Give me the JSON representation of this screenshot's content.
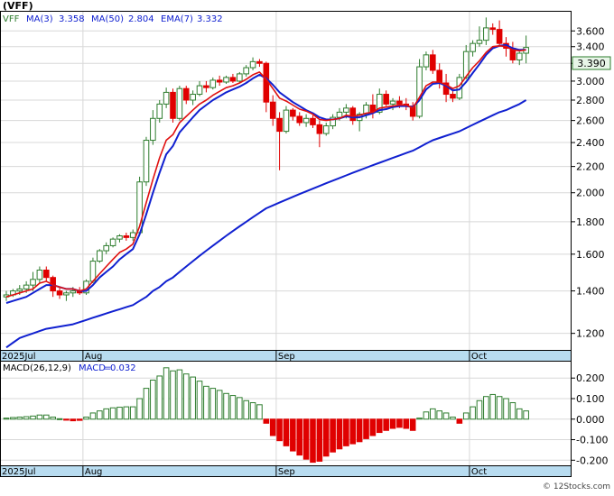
{
  "header": {
    "symbol": "(VFF)",
    "ticker": "VFF",
    "ma3_label": "MA(3)",
    "ma3_value": "3.358",
    "ma50_label": "MA(50)",
    "ma50_value": "2.804",
    "ema7_label": "EMA(7)",
    "ema7_value": "3.332",
    "last_price": "3.390"
  },
  "macd_header": {
    "params": "MACD(26,12,9)",
    "label": "MACD",
    "value": "0.032"
  },
  "x_labels": [
    "2025Jul",
    "Aug",
    "Sep",
    "Oct"
  ],
  "footer": "© 12Stocks.com",
  "colors": {
    "up": "#2e7d2e",
    "down": "#e00000",
    "ma_fast": "#1020d0",
    "ema": "#e01010",
    "ma_slow": "#1020d0",
    "axis_band": "#b8dcf0",
    "grid": "#d8d8d8",
    "price_box": "#e8f5e8"
  },
  "chart_data": [
    {
      "type": "candlestick",
      "title": "VFF",
      "scale": "log",
      "ylim": [
        1.13,
        3.86
      ],
      "yticks": [
        1.2,
        1.4,
        1.6,
        1.8,
        2.0,
        2.2,
        2.4,
        2.6,
        2.8,
        3.0,
        3.2,
        3.4,
        3.6
      ],
      "ytick_labels": [
        "1.200",
        "1.400",
        "1.600",
        "1.800",
        "2.000",
        "2.200",
        "2.400",
        "2.600",
        "2.800",
        "3.000",
        "3.200",
        "3.400",
        "3.600"
      ],
      "x_label_index": {
        "2025Jul": 0,
        "Aug": 12,
        "Sep": 41,
        "Oct": 70
      },
      "ohlc": [
        [
          1.37,
          1.4,
          1.35,
          1.38
        ],
        [
          1.38,
          1.41,
          1.37,
          1.4
        ],
        [
          1.4,
          1.43,
          1.38,
          1.41
        ],
        [
          1.41,
          1.45,
          1.39,
          1.43
        ],
        [
          1.43,
          1.5,
          1.4,
          1.46
        ],
        [
          1.46,
          1.53,
          1.44,
          1.51
        ],
        [
          1.51,
          1.53,
          1.45,
          1.47
        ],
        [
          1.47,
          1.48,
          1.37,
          1.4
        ],
        [
          1.4,
          1.42,
          1.36,
          1.38
        ],
        [
          1.38,
          1.4,
          1.35,
          1.39
        ],
        [
          1.39,
          1.42,
          1.37,
          1.4
        ],
        [
          1.4,
          1.42,
          1.38,
          1.39
        ],
        [
          1.39,
          1.46,
          1.38,
          1.45
        ],
        [
          1.45,
          1.58,
          1.44,
          1.56
        ],
        [
          1.56,
          1.63,
          1.55,
          1.62
        ],
        [
          1.62,
          1.67,
          1.6,
          1.65
        ],
        [
          1.65,
          1.7,
          1.64,
          1.69
        ],
        [
          1.69,
          1.72,
          1.67,
          1.71
        ],
        [
          1.71,
          1.73,
          1.68,
          1.7
        ],
        [
          1.7,
          1.75,
          1.68,
          1.73
        ],
        [
          1.73,
          2.12,
          1.72,
          2.08
        ],
        [
          2.08,
          2.45,
          2.05,
          2.42
        ],
        [
          2.42,
          2.7,
          2.38,
          2.62
        ],
        [
          2.62,
          2.8,
          2.58,
          2.76
        ],
        [
          2.76,
          2.93,
          2.72,
          2.88
        ],
        [
          2.88,
          2.92,
          2.58,
          2.62
        ],
        [
          2.62,
          2.95,
          2.6,
          2.92
        ],
        [
          2.92,
          2.95,
          2.76,
          2.8
        ],
        [
          2.8,
          2.9,
          2.75,
          2.86
        ],
        [
          2.86,
          3.0,
          2.84,
          2.95
        ],
        [
          2.95,
          3.0,
          2.88,
          2.93
        ],
        [
          2.93,
          3.04,
          2.91,
          3.01
        ],
        [
          3.01,
          3.06,
          2.95,
          2.99
        ],
        [
          2.99,
          3.06,
          2.97,
          3.04
        ],
        [
          3.04,
          3.08,
          2.98,
          3.0
        ],
        [
          3.0,
          3.1,
          2.98,
          3.08
        ],
        [
          3.08,
          3.18,
          3.05,
          3.15
        ],
        [
          3.15,
          3.27,
          3.12,
          3.22
        ],
        [
          3.22,
          3.25,
          3.16,
          3.2
        ],
        [
          3.2,
          3.22,
          2.68,
          2.78
        ],
        [
          2.78,
          2.85,
          2.55,
          2.62
        ],
        [
          2.62,
          2.68,
          2.17,
          2.5
        ],
        [
          2.5,
          2.74,
          2.48,
          2.7
        ],
        [
          2.7,
          2.72,
          2.6,
          2.64
        ],
        [
          2.64,
          2.68,
          2.55,
          2.58
        ],
        [
          2.58,
          2.66,
          2.54,
          2.62
        ],
        [
          2.62,
          2.65,
          2.53,
          2.56
        ],
        [
          2.56,
          2.6,
          2.36,
          2.48
        ],
        [
          2.48,
          2.58,
          2.46,
          2.55
        ],
        [
          2.55,
          2.66,
          2.52,
          2.63
        ],
        [
          2.63,
          2.72,
          2.6,
          2.68
        ],
        [
          2.68,
          2.76,
          2.62,
          2.72
        ],
        [
          2.72,
          2.74,
          2.56,
          2.6
        ],
        [
          2.6,
          2.68,
          2.5,
          2.66
        ],
        [
          2.66,
          2.78,
          2.62,
          2.75
        ],
        [
          2.75,
          2.86,
          2.62,
          2.68
        ],
        [
          2.68,
          2.92,
          2.66,
          2.86
        ],
        [
          2.86,
          2.9,
          2.74,
          2.76
        ],
        [
          2.76,
          2.82,
          2.7,
          2.79
        ],
        [
          2.79,
          2.84,
          2.72,
          2.76
        ],
        [
          2.76,
          2.82,
          2.7,
          2.74
        ],
        [
          2.74,
          2.78,
          2.6,
          2.64
        ],
        [
          2.64,
          3.25,
          2.62,
          3.16
        ],
        [
          3.16,
          3.34,
          3.12,
          3.3
        ],
        [
          3.3,
          3.36,
          3.08,
          3.12
        ],
        [
          3.12,
          3.2,
          2.92,
          2.98
        ],
        [
          2.98,
          3.08,
          2.78,
          2.86
        ],
        [
          2.86,
          2.9,
          2.78,
          2.82
        ],
        [
          2.82,
          3.08,
          2.8,
          3.04
        ],
        [
          3.04,
          3.42,
          3.02,
          3.34
        ],
        [
          3.34,
          3.48,
          3.28,
          3.44
        ],
        [
          3.44,
          3.66,
          3.4,
          3.48
        ],
        [
          3.48,
          3.78,
          3.42,
          3.64
        ],
        [
          3.64,
          3.7,
          3.55,
          3.62
        ],
        [
          3.62,
          3.74,
          3.4,
          3.44
        ],
        [
          3.44,
          3.52,
          3.28,
          3.38
        ],
        [
          3.38,
          3.46,
          3.2,
          3.24
        ],
        [
          3.24,
          3.34,
          3.18,
          3.32
        ],
        [
          3.32,
          3.54,
          3.2,
          3.39
        ]
      ],
      "ma3": [
        1.37,
        1.39,
        1.4,
        1.41,
        1.43,
        1.47,
        1.48,
        1.46,
        1.42,
        1.39,
        1.39,
        1.39,
        1.41,
        1.47,
        1.54,
        1.61,
        1.65,
        1.68,
        1.7,
        1.71,
        1.84,
        2.08,
        2.37,
        2.6,
        2.75,
        2.75,
        2.81,
        2.85,
        2.86,
        2.87,
        2.91,
        2.96,
        2.98,
        3.01,
        3.01,
        3.04,
        3.08,
        3.15,
        3.19,
        3.07,
        2.87,
        2.63,
        2.61,
        2.61,
        2.64,
        2.61,
        2.59,
        2.55,
        2.53,
        2.55,
        2.62,
        2.68,
        2.67,
        2.66,
        2.7,
        2.7,
        2.76,
        2.77,
        2.8,
        2.77,
        2.76,
        2.71,
        2.85,
        3.03,
        3.19,
        3.13,
        2.99,
        2.89,
        2.91,
        3.07,
        3.27,
        3.42,
        3.52,
        3.58,
        3.57,
        3.48,
        3.35,
        3.31,
        3.36
      ],
      "ema7": [
        1.37,
        1.38,
        1.39,
        1.4,
        1.41,
        1.44,
        1.45,
        1.43,
        1.42,
        1.41,
        1.41,
        1.4,
        1.41,
        1.45,
        1.49,
        1.53,
        1.57,
        1.61,
        1.63,
        1.66,
        1.77,
        1.93,
        2.1,
        2.27,
        2.42,
        2.47,
        2.58,
        2.64,
        2.7,
        2.76,
        2.8,
        2.85,
        2.89,
        2.93,
        2.95,
        2.98,
        3.02,
        3.07,
        3.1,
        3.02,
        2.92,
        2.82,
        2.79,
        2.75,
        2.71,
        2.69,
        2.66,
        2.61,
        2.6,
        2.61,
        2.62,
        2.65,
        2.64,
        2.65,
        2.67,
        2.68,
        2.72,
        2.73,
        2.74,
        2.75,
        2.75,
        2.72,
        2.83,
        2.95,
        2.99,
        2.99,
        2.96,
        2.92,
        2.95,
        3.05,
        3.15,
        3.23,
        3.33,
        3.4,
        3.41,
        3.4,
        3.36,
        3.35,
        3.36
      ],
      "ma_fast": [
        1.34,
        1.35,
        1.36,
        1.37,
        1.39,
        1.41,
        1.43,
        1.43,
        1.42,
        1.41,
        1.41,
        1.4,
        1.4,
        1.43,
        1.47,
        1.5,
        1.53,
        1.57,
        1.6,
        1.63,
        1.72,
        1.85,
        2.0,
        2.15,
        2.3,
        2.37,
        2.49,
        2.56,
        2.63,
        2.7,
        2.75,
        2.8,
        2.84,
        2.88,
        2.91,
        2.94,
        2.98,
        3.03,
        3.07,
        3.03,
        2.96,
        2.88,
        2.83,
        2.78,
        2.74,
        2.7,
        2.67,
        2.63,
        2.61,
        2.61,
        2.62,
        2.64,
        2.63,
        2.63,
        2.65,
        2.67,
        2.7,
        2.71,
        2.73,
        2.74,
        2.74,
        2.73,
        2.8,
        2.91,
        2.97,
        2.98,
        2.95,
        2.9,
        2.91,
        2.99,
        3.09,
        3.19,
        3.3,
        3.38,
        3.41,
        3.42,
        3.38,
        3.36,
        3.36
      ],
      "ma_slow": [
        1.14,
        1.16,
        1.18,
        1.19,
        1.2,
        1.21,
        1.22,
        1.225,
        1.23,
        1.235,
        1.24,
        1.25,
        1.26,
        1.27,
        1.28,
        1.29,
        1.3,
        1.31,
        1.32,
        1.33,
        1.35,
        1.37,
        1.4,
        1.42,
        1.45,
        1.47,
        1.5,
        1.53,
        1.56,
        1.59,
        1.62,
        1.65,
        1.68,
        1.71,
        1.74,
        1.77,
        1.8,
        1.83,
        1.86,
        1.89,
        1.91,
        1.93,
        1.95,
        1.97,
        1.99,
        2.01,
        2.03,
        2.05,
        2.07,
        2.09,
        2.11,
        2.13,
        2.15,
        2.17,
        2.19,
        2.21,
        2.23,
        2.25,
        2.27,
        2.29,
        2.31,
        2.33,
        2.36,
        2.39,
        2.42,
        2.44,
        2.46,
        2.48,
        2.5,
        2.53,
        2.56,
        2.59,
        2.62,
        2.65,
        2.68,
        2.7,
        2.73,
        2.76,
        2.8
      ]
    },
    {
      "type": "bar",
      "title": "MACD(26,12,9)",
      "ylim": [
        -0.225,
        0.28
      ],
      "yticks": [
        -0.2,
        -0.1,
        0.0,
        0.1,
        0.2
      ],
      "ytick_labels": [
        "-0.200",
        "-0.100",
        "0.000",
        "0.100",
        "0.200"
      ],
      "values": [
        0.005,
        0.008,
        0.01,
        0.012,
        0.015,
        0.02,
        0.02,
        0.01,
        0.002,
        -0.005,
        -0.008,
        -0.006,
        0.01,
        0.03,
        0.04,
        0.05,
        0.055,
        0.058,
        0.06,
        0.06,
        0.1,
        0.15,
        0.19,
        0.21,
        0.25,
        0.235,
        0.24,
        0.22,
        0.205,
        0.185,
        0.16,
        0.15,
        0.14,
        0.125,
        0.115,
        0.105,
        0.09,
        0.08,
        0.07,
        -0.02,
        -0.08,
        -0.105,
        -0.13,
        -0.155,
        -0.175,
        -0.195,
        -0.21,
        -0.205,
        -0.18,
        -0.16,
        -0.145,
        -0.13,
        -0.12,
        -0.11,
        -0.095,
        -0.08,
        -0.065,
        -0.055,
        -0.045,
        -0.04,
        -0.045,
        -0.055,
        0.005,
        0.035,
        0.05,
        0.04,
        0.03,
        0.01,
        -0.02,
        0.03,
        0.06,
        0.09,
        0.11,
        0.12,
        0.11,
        0.1,
        0.08,
        0.05,
        0.04
      ]
    }
  ]
}
